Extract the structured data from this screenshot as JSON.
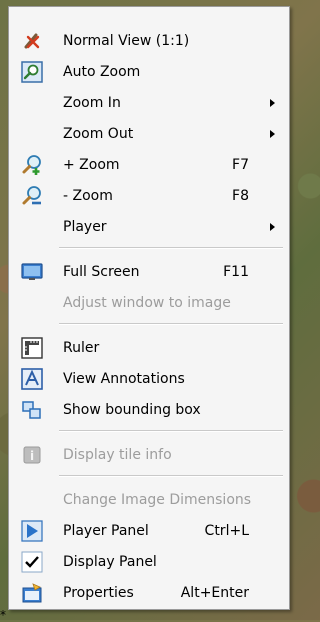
{
  "menu": {
    "items": [
      {
        "label": "Normal View (1:1)",
        "icon": "normal-view-icon"
      },
      {
        "label": "Auto Zoom",
        "icon": "auto-zoom-icon"
      },
      {
        "label": "Zoom In",
        "icon": "none",
        "submenu": true
      },
      {
        "label": "Zoom Out",
        "icon": "none",
        "submenu": true
      },
      {
        "label": "+ Zoom",
        "icon": "zoom-plus-icon",
        "shortcut": "F7"
      },
      {
        "label": "- Zoom",
        "icon": "zoom-minus-icon",
        "shortcut": "F8"
      },
      {
        "label": "Player",
        "icon": "none",
        "submenu": true
      },
      {
        "label": "Full Screen",
        "icon": "full-screen-icon",
        "shortcut": "F11"
      },
      {
        "label": "Adjust window to image",
        "icon": "none",
        "disabled": true
      },
      {
        "label": "Ruler",
        "icon": "ruler-icon"
      },
      {
        "label": "View Annotations",
        "icon": "annotations-icon"
      },
      {
        "label": "Show bounding box",
        "icon": "bounding-box-icon"
      },
      {
        "label": "Display tile info",
        "icon": "info-icon",
        "disabled": true
      },
      {
        "label": "Change Image Dimensions",
        "icon": "none",
        "disabled": true
      },
      {
        "label": "Player Panel",
        "icon": "play-icon",
        "shortcut": "Ctrl+L"
      },
      {
        "label": "Display Panel",
        "icon": "check-icon"
      },
      {
        "label": "Properties",
        "icon": "properties-icon",
        "shortcut": "Alt+Enter"
      }
    ]
  },
  "corner_mark": "*"
}
